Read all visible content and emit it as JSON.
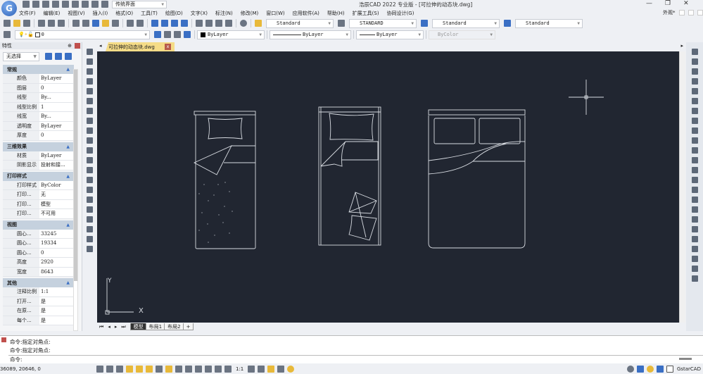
{
  "app": {
    "title": "浩辰CAD 2022 专业版 - [可拉伸的动态块.dwg]",
    "workspace": "传统界面",
    "appearance": "外观*"
  },
  "menu": [
    "文件(F)",
    "编辑(E)",
    "视图(V)",
    "插入(I)",
    "格式(O)",
    "工具(T)",
    "绘图(D)",
    "文字(X)",
    "标注(N)",
    "修改(M)",
    "窗口(W)",
    "应用软件(A)",
    "帮助(H)",
    "扩展工具(S)",
    "协同设计(G)"
  ],
  "toolbar": {
    "text_style": "Standard",
    "dim_style": "STANDARD",
    "table_style": "Standard",
    "multileader_style": "Standard",
    "layer": "0",
    "color": "ByLayer",
    "linetype": "ByLayer",
    "lineweight": "ByLayer",
    "plot_style": "ByColor"
  },
  "document_tab": "可拉伸的动态块.dwg",
  "properties": {
    "title": "特性",
    "selection": "无选择",
    "sections": [
      {
        "name": "常规",
        "rows": [
          [
            "颜色",
            "ByLayer"
          ],
          [
            "图层",
            "0"
          ],
          [
            "线型",
            "By..."
          ],
          [
            "线型比例",
            "1"
          ],
          [
            "线宽",
            "By..."
          ],
          [
            "透明度",
            "ByLayer"
          ],
          [
            "厚度",
            "0"
          ]
        ]
      },
      {
        "name": "三维效果",
        "rows": [
          [
            "材质",
            "ByLayer"
          ],
          [
            "阴影显示",
            "投射和接..."
          ]
        ]
      },
      {
        "name": "打印样式",
        "rows": [
          [
            "打印样式",
            "ByColor"
          ],
          [
            "打印...",
            "无"
          ],
          [
            "打印...",
            "模型"
          ],
          [
            "打印...",
            "不可用"
          ]
        ]
      },
      {
        "name": "视图",
        "rows": [
          [
            "圆心...",
            "33245"
          ],
          [
            "圆心...",
            "19334"
          ],
          [
            "圆心...",
            "0"
          ],
          [
            "高度",
            "2920"
          ],
          [
            "宽度",
            "8643"
          ]
        ]
      },
      {
        "name": "其他",
        "rows": [
          [
            "注释比例",
            "1:1"
          ],
          [
            "打开...",
            "是"
          ],
          [
            "在原...",
            "是"
          ],
          [
            "每个...",
            "是"
          ]
        ]
      }
    ]
  },
  "ucs": {
    "x": "X",
    "y": "Y"
  },
  "layout_tabs": [
    "模型",
    "布局1",
    "布局2",
    "+"
  ],
  "command": {
    "history": [
      "命令:指定对角点:",
      "命令:指定对角点:"
    ],
    "prompt": "命令:"
  },
  "status": {
    "coords": "36089, 20646, 0",
    "scale": "1:1",
    "brand": "GstarCAD"
  },
  "colors": {
    "canvas": "#212631",
    "lines": "#d8dce2",
    "accent": "#3a6fc4"
  }
}
